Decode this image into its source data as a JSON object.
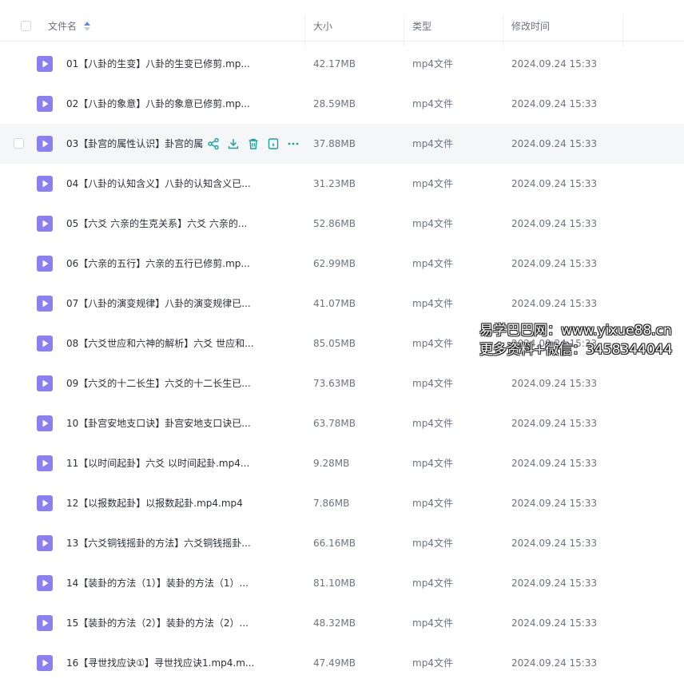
{
  "header": {
    "name_label": "文件名",
    "size_label": "大小",
    "type_label": "类型",
    "time_label": "修改时间"
  },
  "colors": {
    "video_icon": "#8b80f2",
    "action_icon": "#16a3a3",
    "hover_row": "#f5f6f8"
  },
  "icons": {
    "file": "video-file-icon",
    "actions": [
      "share-icon",
      "download-icon",
      "delete-icon",
      "info-icon",
      "more-icon"
    ]
  },
  "files": [
    {
      "name": "01【八卦的生变】八卦的生变已修剪.mp...",
      "size": "42.17MB",
      "type": "mp4文件",
      "time": "2024.09.24 15:33"
    },
    {
      "name": "02【八卦的象意】八卦的象意已修剪.mp...",
      "size": "28.59MB",
      "type": "mp4文件",
      "time": "2024.09.24 15:33"
    },
    {
      "name": "03【卦宫的属性认识】卦宫的属",
      "size": "37.88MB",
      "type": "mp4文件",
      "time": "2024.09.24 15:33",
      "hovered": true
    },
    {
      "name": "04【八卦的认知含义】八卦的认知含义已...",
      "size": "31.23MB",
      "type": "mp4文件",
      "time": "2024.09.24 15:33"
    },
    {
      "name": "05【六爻 六亲的生克关系】六爻 六亲的...",
      "size": "52.86MB",
      "type": "mp4文件",
      "time": "2024.09.24 15:33"
    },
    {
      "name": "06【六亲的五行】六亲的五行已修剪.mp...",
      "size": "62.99MB",
      "type": "mp4文件",
      "time": "2024.09.24 15:33"
    },
    {
      "name": "07【八卦的演变规律】八卦的演变规律已...",
      "size": "41.07MB",
      "type": "mp4文件",
      "time": "2024.09.24 15:33"
    },
    {
      "name": "08【六爻世应和六神的解析】六爻 世应和...",
      "size": "85.05MB",
      "type": "mp4文件",
      "time": "2024.09.24 15:33"
    },
    {
      "name": "09【六爻的十二长生】六爻的十二长生已...",
      "size": "73.63MB",
      "type": "mp4文件",
      "time": "2024.09.24 15:33"
    },
    {
      "name": "10【卦宫安地支口诀】卦宫安地支口诀已...",
      "size": "63.78MB",
      "type": "mp4文件",
      "time": "2024.09.24 15:33"
    },
    {
      "name": "11【以时间起卦】六爻 以时间起卦.mp4...",
      "size": "9.28MB",
      "type": "mp4文件",
      "time": "2024.09.24 15:33"
    },
    {
      "name": "12【以报数起卦】以报数起卦.mp4.mp4",
      "size": "7.86MB",
      "type": "mp4文件",
      "time": "2024.09.24 15:33"
    },
    {
      "name": "13【六爻铜钱摇卦的方法】六爻铜钱摇卦...",
      "size": "66.16MB",
      "type": "mp4文件",
      "time": "2024.09.24 15:33"
    },
    {
      "name": "14【装卦的方法（1）】装卦的方法（1）...",
      "size": "81.10MB",
      "type": "mp4文件",
      "time": "2024.09.24 15:33"
    },
    {
      "name": "15【装卦的方法（2）】装卦的方法（2）...",
      "size": "48.32MB",
      "type": "mp4文件",
      "time": "2024.09.24 15:33"
    },
    {
      "name": "16【寻世找应诀①】寻世找应诀1.mp4.m...",
      "size": "47.49MB",
      "type": "mp4文件",
      "time": "2024.09.24 15:33"
    }
  ],
  "watermark": {
    "line1": "易学巴巴网：www.yixue88.cn",
    "line2": "更多资料+微信：3458344044"
  }
}
